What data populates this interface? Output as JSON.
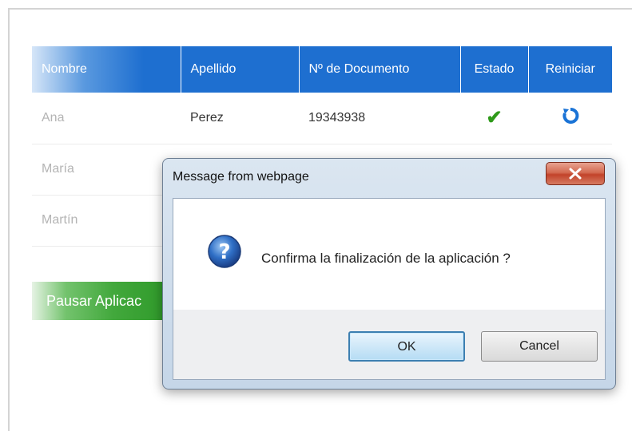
{
  "table": {
    "headers": {
      "nombre": "Nombre",
      "apellido": "Apellido",
      "documento": "Nº de Documento",
      "estado": "Estado",
      "reiniciar": "Reiniciar"
    },
    "rows": [
      {
        "nombre": "Ana",
        "apellido": "Perez",
        "documento": "19343938"
      },
      {
        "nombre": "María",
        "apellido": "",
        "documento": ""
      },
      {
        "nombre": "Martín",
        "apellido": "",
        "documento": ""
      }
    ],
    "status_icon": "check-icon",
    "reset_icon": "reset-icon"
  },
  "actions": {
    "pause_label": "Pausar Aplicac"
  },
  "dialog": {
    "title": "Message from webpage",
    "message": "Confirma la finalización de la aplicación ?",
    "ok_label": "OK",
    "cancel_label": "Cancel",
    "icon": "question-icon",
    "close_icon": "close-icon"
  },
  "colors": {
    "header_blue": "#1e6fd0",
    "check_green": "#2f9a1a",
    "pause_green": "#42a83c",
    "reset_blue": "#1a73d6"
  }
}
